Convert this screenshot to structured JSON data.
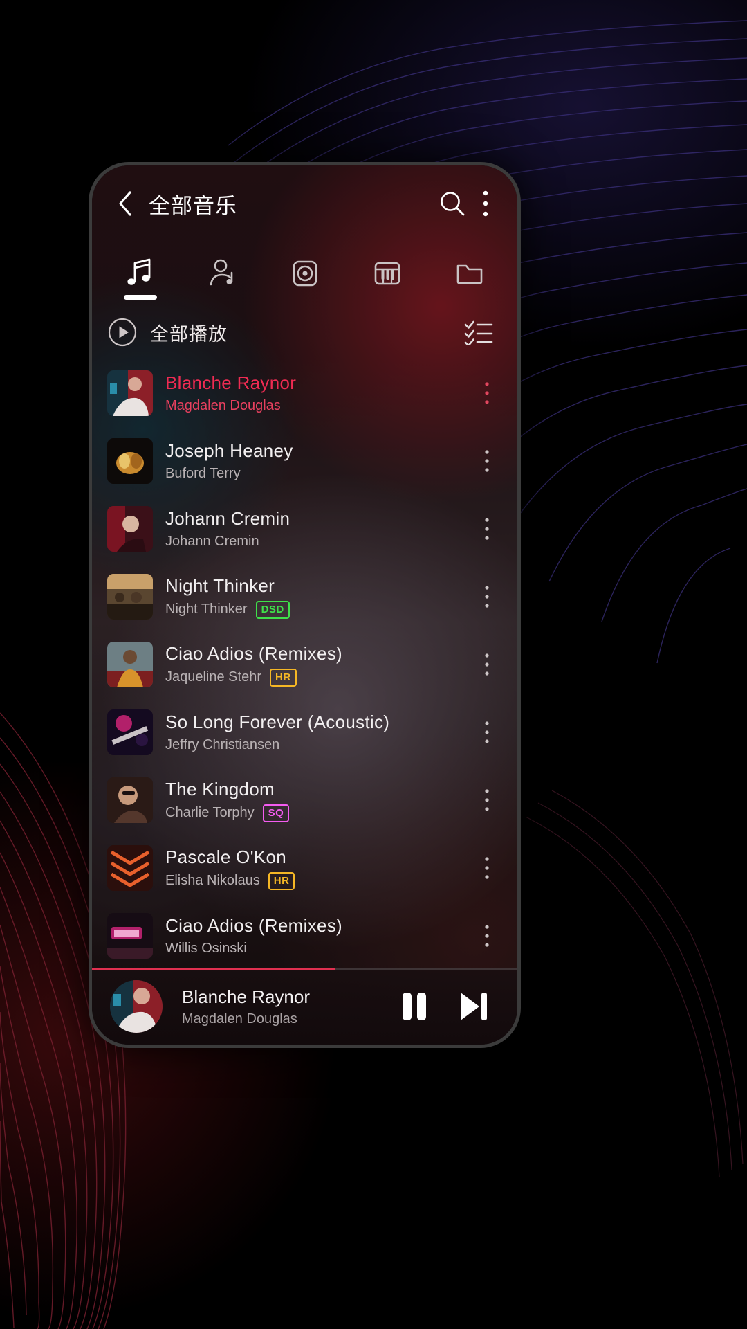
{
  "header": {
    "back_icon": "chevron-left-icon",
    "title": "全部音乐",
    "search_icon": "search-icon",
    "menu_icon": "overflow-menu-icon"
  },
  "tabs": [
    {
      "name": "songs",
      "icon": "music-note-icon",
      "active": true
    },
    {
      "name": "artists",
      "icon": "artist-icon",
      "active": false
    },
    {
      "name": "albums",
      "icon": "album-disc-icon",
      "active": false
    },
    {
      "name": "genres",
      "icon": "piano-icon",
      "active": false
    },
    {
      "name": "folders",
      "icon": "folder-icon",
      "active": false
    }
  ],
  "playall": {
    "play_icon": "play-circle-icon",
    "label": "全部播放",
    "multiselect_icon": "checklist-icon"
  },
  "songs": [
    {
      "title": "Blanche Raynor",
      "artist": "Magdalen Douglas",
      "badge": "",
      "active": true
    },
    {
      "title": "Joseph Heaney",
      "artist": "Buford Terry",
      "badge": "",
      "active": false
    },
    {
      "title": "Johann Cremin",
      "artist": "Johann Cremin",
      "badge": "",
      "active": false
    },
    {
      "title": "Night Thinker",
      "artist": "Night Thinker",
      "badge": "DSD",
      "active": false
    },
    {
      "title": "Ciao Adios (Remixes)",
      "artist": "Jaqueline Stehr",
      "badge": "HR",
      "active": false
    },
    {
      "title": "So Long Forever (Acoustic)",
      "artist": "Jeffry Christiansen",
      "badge": "",
      "active": false
    },
    {
      "title": "The Kingdom",
      "artist": "Charlie Torphy",
      "badge": "SQ",
      "active": false
    },
    {
      "title": "Pascale O'Kon",
      "artist": "Elisha Nikolaus",
      "badge": "HR",
      "active": false
    },
    {
      "title": "Ciao Adios (Remixes)",
      "artist": "Willis Osinski",
      "badge": "",
      "active": false
    }
  ],
  "player": {
    "title": "Blanche Raynor",
    "artist": "Magdalen Douglas",
    "pause_icon": "pause-icon",
    "next_icon": "skip-next-icon",
    "progress_percent": 57
  },
  "colors": {
    "accent": "#ef2b52",
    "badge_dsd": "#3fe04a",
    "badge_hr": "#f5b725",
    "badge_sq": "#f45cf0",
    "text_primary": "#f2eff0",
    "text_secondary": "#b9b2b4"
  }
}
